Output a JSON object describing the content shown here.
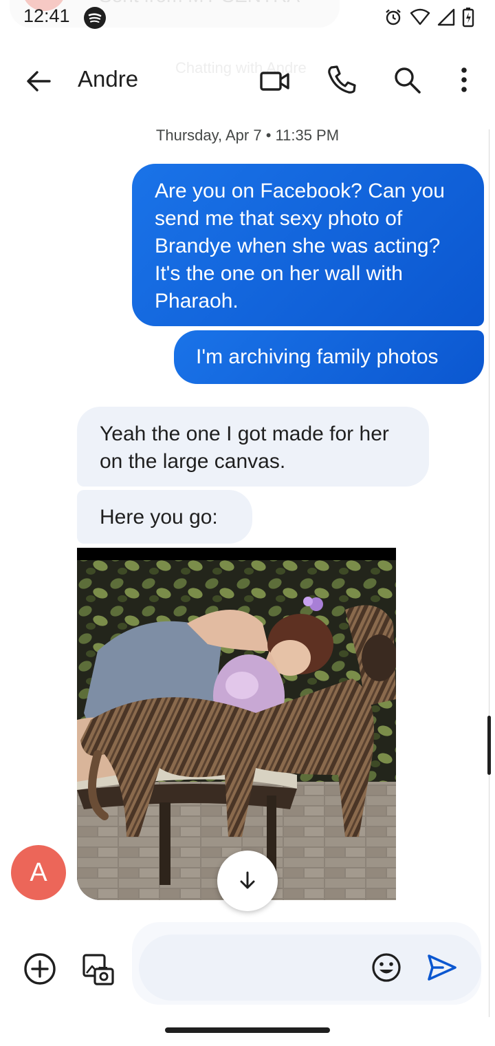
{
  "status_bar": {
    "time": "12:41",
    "notification_ghost_text": "Sent from MY SENTRA",
    "icons": [
      "spotify-icon",
      "alarm-icon",
      "wifi-icon",
      "signal-icon",
      "battery-charging-icon"
    ]
  },
  "app_bar": {
    "contact_name": "Andre",
    "ghost_subtitle": "Chatting with Andre",
    "icons": [
      "back-arrow-icon",
      "video-call-icon",
      "phone-icon",
      "search-icon",
      "more-vert-icon"
    ]
  },
  "conversation": {
    "timestamp": "Thursday, Apr 7 • 11:35 PM",
    "messages": [
      {
        "direction": "sent",
        "text": "Are you on Facebook? Can you send me that sexy photo of Brandye when she was acting? It's the one on her wall with Pharaoh."
      },
      {
        "direction": "sent",
        "text": "I'm archiving family photos"
      },
      {
        "direction": "received",
        "text": "Yeah the one I got made for her on the large canvas."
      },
      {
        "direction": "received",
        "text": "Here you go:"
      },
      {
        "direction": "received",
        "type": "image",
        "depicts": "woman embracing a brindle dog"
      }
    ],
    "sender_avatar_letter": "A",
    "sender_avatar_color": "#ec6659"
  },
  "compose": {
    "value": "",
    "icons": [
      "add-circle-icon",
      "gallery-icon",
      "emoji-icon",
      "send-icon"
    ]
  },
  "colors": {
    "sent_bubble": "#0b57d0",
    "received_bubble": "#eef2f9",
    "send_icon": "#0b57d0"
  }
}
